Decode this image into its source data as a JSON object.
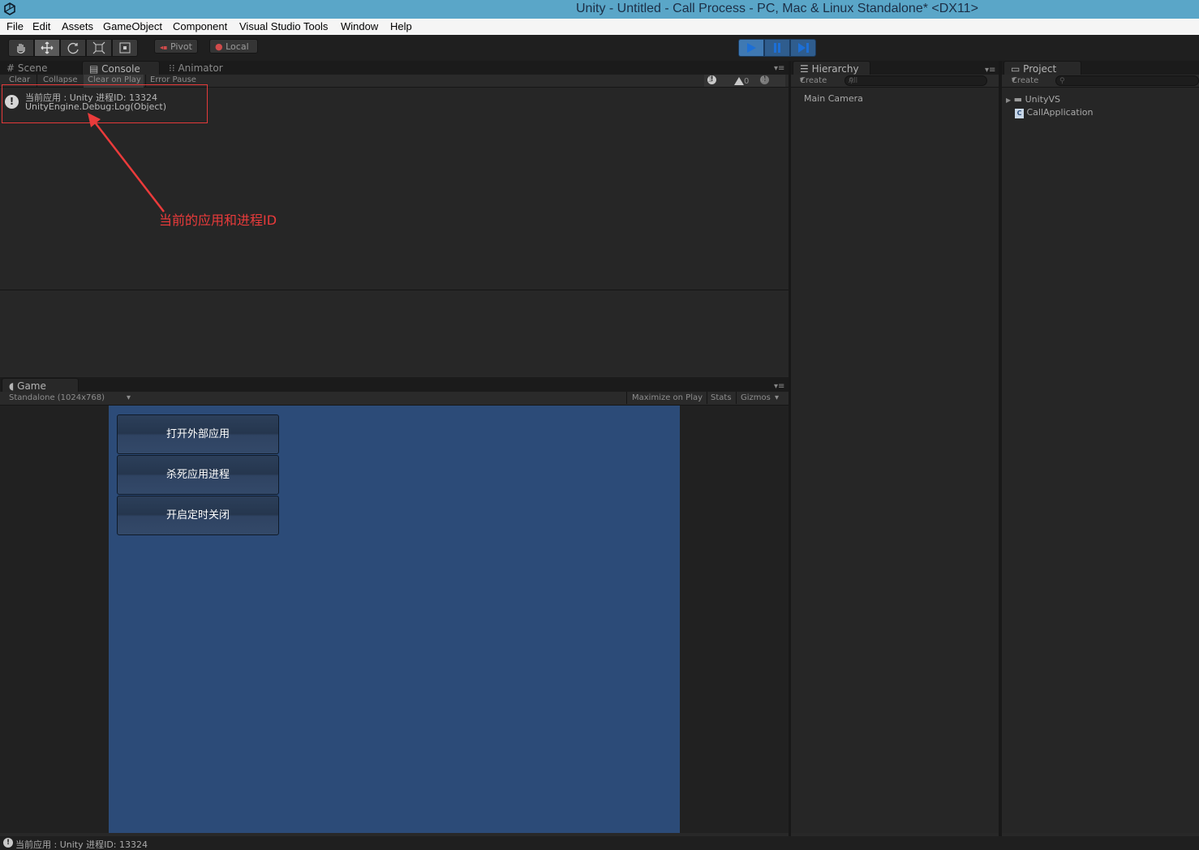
{
  "window": {
    "title": "Unity - Untitled - Call Process - PC, Mac & Linux Standalone* <DX11>"
  },
  "menu": [
    "File",
    "Edit",
    "Assets",
    "GameObject",
    "Component",
    "Visual Studio Tools",
    "Window",
    "Help"
  ],
  "toolbar": {
    "tools": [
      "hand-tool-icon",
      "move-tool-icon",
      "rotate-tool-icon",
      "scale-tool-icon",
      "rect-tool-icon"
    ],
    "pivot_label": "Pivot",
    "local_label": "Local"
  },
  "top_left_panel": {
    "tabs": [
      "Scene",
      "Console",
      "Animator"
    ],
    "active_tab": "Console",
    "console_buttons": [
      "Clear",
      "Collapse",
      "Clear on Play",
      "Error Pause"
    ],
    "counts": {
      "info": "1",
      "warnings": "0",
      "errors": "0"
    },
    "log_entry": {
      "line1": "当前应用 : Unity 进程ID: 13324",
      "line2": "UnityEngine.Debug:Log(Object)"
    }
  },
  "annotation": {
    "text": "当前的应用和进程ID",
    "color": "#ea3b3b"
  },
  "game_panel": {
    "tab": "Game",
    "resolution": "Standalone (1024x768)",
    "options": [
      "Maximize on Play",
      "Stats",
      "Gizmos"
    ],
    "buttons": [
      "打开外部应用",
      "杀死应用进程",
      "开启定时关闭"
    ]
  },
  "hierarchy": {
    "tab": "Hierarchy",
    "create_label": "Create",
    "search_placeholder": "All",
    "items": [
      "Main Camera"
    ]
  },
  "project": {
    "tab": "Project",
    "create_label": "Create",
    "items": [
      "UnityVS",
      "CallApplication"
    ]
  },
  "status_bar": {
    "message": "当前应用 : Unity 进程ID: 13324"
  }
}
